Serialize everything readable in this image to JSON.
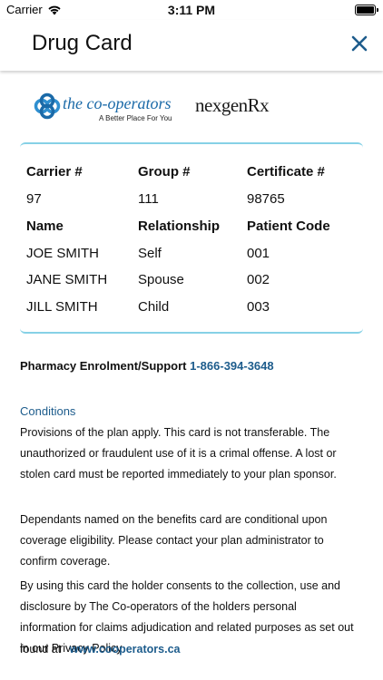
{
  "status_bar": {
    "carrier": "Carrier",
    "time": "3:11 PM"
  },
  "header": {
    "title": "Drug Card",
    "close_icon": "close-icon"
  },
  "logos": {
    "coop_name": "the co-operators",
    "coop_tagline": "A Better Place For You",
    "nexgen_name": "nexgenRx"
  },
  "card": {
    "header_row_1": [
      "Carrier #",
      "Group #",
      "Certificate #"
    ],
    "value_row_1": [
      "97",
      "111",
      "98765"
    ],
    "header_row_2": [
      "Name",
      "Relationship",
      "Patient Code"
    ],
    "members": [
      {
        "name": "JOE SMITH",
        "relationship": "Self",
        "code": "001"
      },
      {
        "name": "JANE SMITH",
        "relationship": "Spouse",
        "code": "002"
      },
      {
        "name": "JILL SMITH",
        "relationship": "Child",
        "code": "003"
      }
    ]
  },
  "support": {
    "label": "Pharmacy Enrolment/Support",
    "phone": "1-866-394-3648"
  },
  "conditions": {
    "title": "Conditions",
    "paragraph_1": "Provisions of the plan apply. This card is not transferable. The unauthorized or fraudulent use of it is a crimal offense. A lost or stolen card must be reported immediately to your plan sponsor.",
    "paragraph_2": "Dependants named on the benefits card are conditional upon coverage eligibility. Please contact your plan administrator to confirm coverage.",
    "paragraph_3": "By using this card the holder consents to the collection, use and disclosure by The Co-operators of the holders personal information for claims adjudication and related purposes as set out in our Privacy Policy",
    "found_at": "found at",
    "link": "www.cooperators.ca"
  },
  "colors": {
    "accent": "#1d5c8c",
    "card_border": "#86d1e6",
    "coop_blue": "#1b6aa8"
  }
}
